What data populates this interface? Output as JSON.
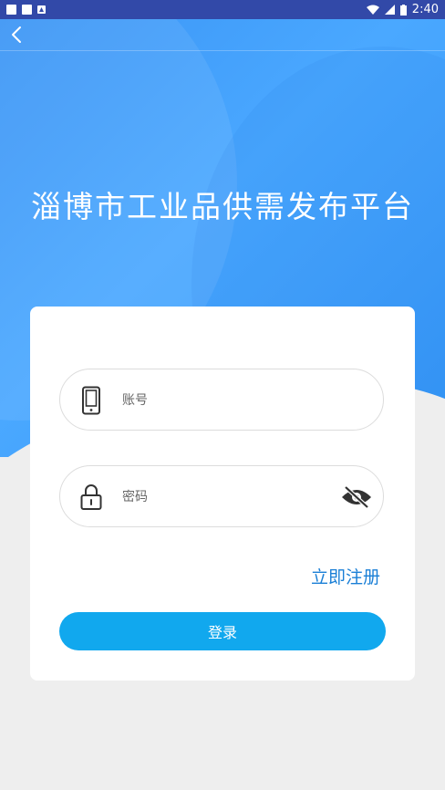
{
  "status_bar": {
    "time": "2:40"
  },
  "header": {
    "title": "淄博市工业品供需发布平台"
  },
  "login_form": {
    "account_placeholder": "账号",
    "password_placeholder": "密码",
    "register_label": "立即注册",
    "login_label": "登录"
  },
  "icons": {
    "back": "chevron-left",
    "account": "phone",
    "password": "lock",
    "toggle": "eye-off"
  },
  "colors": {
    "status_bar": "#3249a8",
    "hero": "#4aa8ff",
    "accent": "#1a7fd6",
    "button": "#11a8ee"
  }
}
